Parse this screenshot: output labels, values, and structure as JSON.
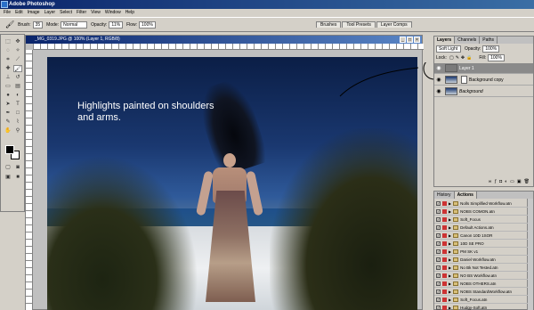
{
  "app": {
    "title": "Adobe Photoshop"
  },
  "menu": [
    "File",
    "Edit",
    "Image",
    "Layer",
    "Select",
    "Filter",
    "View",
    "Window",
    "Help"
  ],
  "options": {
    "brush_label": "Brush:",
    "brush_size": "35",
    "mode_label": "Mode:",
    "mode_value": "Normal",
    "opacity_label": "Opacity:",
    "opacity_value": "11%",
    "flow_label": "Flow:",
    "flow_value": "100%"
  },
  "palette_well": [
    "Brushes",
    "Tool Presets",
    "Layer Comps"
  ],
  "document": {
    "title": "_MG_0319.JPG @ 100% (Layer 1, RGB/8)",
    "caption": "Highlights painted on shoulders and arms."
  },
  "layers_panel": {
    "tabs": [
      "Layers",
      "Channels",
      "Paths"
    ],
    "blend_mode": "Soft Light",
    "opacity_label": "Opacity:",
    "opacity_value": "100%",
    "lock_label": "Lock:",
    "fill_label": "Fill:",
    "fill_value": "100%",
    "layers": [
      {
        "name": "Layer 1"
      },
      {
        "name": "Background copy"
      },
      {
        "name": "Background"
      }
    ]
  },
  "actions_panel": {
    "tabs": [
      "History",
      "Actions"
    ],
    "items": [
      "Nolls Simplified Workflow.atn",
      "NOBS COMON.atn",
      "Soft_Focus",
      "Default Actions.atn",
      "Canon 10D 1SOR",
      "10D SE PRO",
      "PM SK v1",
      "Daniel Workflow.atn",
      "No Bk Not Tested.atn",
      "NO BS Workflow.atn",
      "NOBS OTHERS.atn",
      "NOBS StandardWorkflow.atn",
      "Soft_Focus.atn",
      "Hudgy-Soft.atn"
    ]
  },
  "colors": {
    "title_bar": "#0a246a",
    "canvas_sky": "#1a3870",
    "sand": "#e6e9ec"
  }
}
